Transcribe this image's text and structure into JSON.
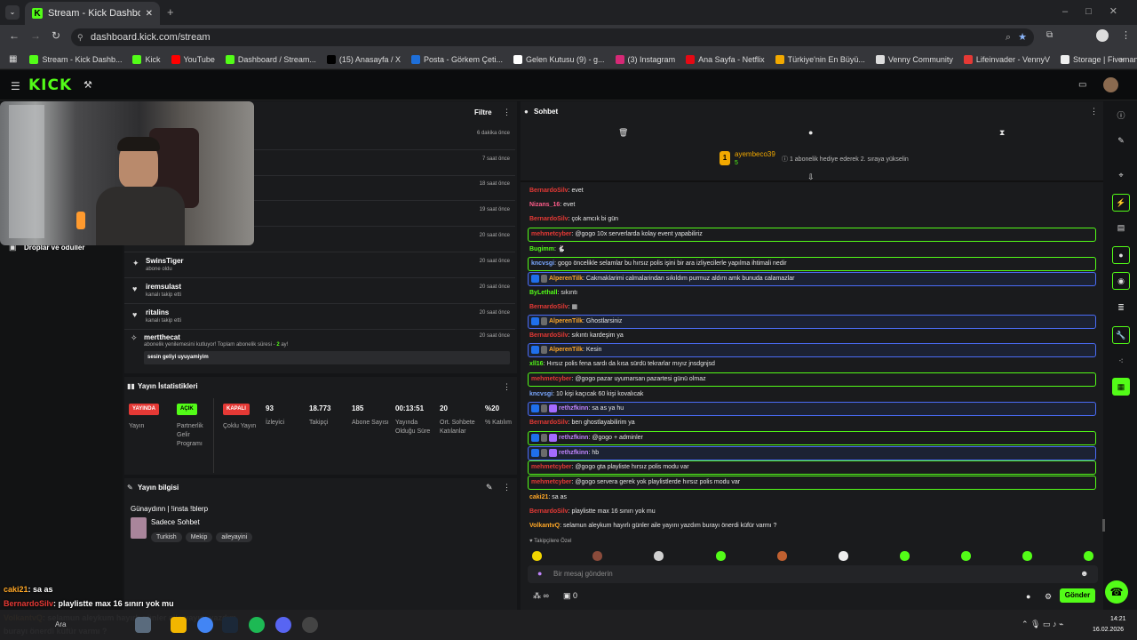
{
  "browser": {
    "tab_title": "Stream - Kick Dashboard",
    "url": "dashboard.kick.com/stream",
    "bookmarks": [
      {
        "label": "Stream - Kick Dashb...",
        "color": "#53fc18"
      },
      {
        "label": "Kick",
        "color": "#53fc18"
      },
      {
        "label": "YouTube",
        "color": "#ff0000"
      },
      {
        "label": "Dashboard / Stream...",
        "color": "#53fc18"
      },
      {
        "label": "(15) Anasayfa / X",
        "color": "#000000"
      },
      {
        "label": "Posta - Görkem Çeti...",
        "color": "#1e6fd9"
      },
      {
        "label": "Gelen Kutusu (9) - g...",
        "color": "#ffffff"
      },
      {
        "label": "(3) Instagram",
        "color": "#d62976"
      },
      {
        "label": "Ana Sayfa - Netflix",
        "color": "#e50914"
      },
      {
        "label": "Türkiye'nin En Büyü...",
        "color": "#f2a900"
      },
      {
        "label": "Venny Community",
        "color": "#dddddd"
      },
      {
        "label": "Lifeinvader - VennyV",
        "color": "#e53935"
      },
      {
        "label": "Storage | Fivemanage",
        "color": "#eeeeee"
      }
    ]
  },
  "kick": {
    "logo": "KICK"
  },
  "activity": {
    "filter_label": "Filtre",
    "items": [
      {
        "name": "",
        "sub": "",
        "time": "6 dakika önce",
        "icon": "none"
      },
      {
        "name": "",
        "sub": "",
        "time": "7 saat önce",
        "icon": "none"
      },
      {
        "name": "",
        "sub": "",
        "time": "18 saat önce",
        "icon": "none"
      },
      {
        "name": "",
        "sub": "",
        "time": "19 saat önce",
        "icon": "none"
      },
      {
        "name": "",
        "sub": "abone oldu",
        "time": "20 saat önce",
        "icon": "none"
      },
      {
        "name": "SwinsTiger",
        "sub": "abone oldu",
        "time": "20 saat önce",
        "icon": "✦"
      },
      {
        "name": "iremsulast",
        "sub": "kanalı takip etti",
        "time": "20 saat önce",
        "icon": "♥"
      },
      {
        "name": "ritalins",
        "sub": "kanalı takip etti",
        "time": "20 saat önce",
        "icon": "♥"
      }
    ],
    "resub": {
      "name": "mertthecat",
      "sub_prefix": "abonelik yenilemesini kutluyor! Toplam abonelik süresi -",
      "months": "2",
      "sub_suffix": "ay!",
      "message": "sesin geliyi uyuyamiyim",
      "time": "20 saat önce"
    }
  },
  "sidebar": {
    "drops_label": "Droplar ve ödüller"
  },
  "stats": {
    "title": "Yayın İstatistikleri",
    "badges": [
      {
        "tag": "YAYINDA",
        "label": "Yayın",
        "color": "#e53935",
        "text": "#ffffff"
      },
      {
        "tag": "AÇIK",
        "label": "Partnerlik Gelir Programı",
        "color": "#53fc18",
        "text": "#000000"
      },
      {
        "tag": "KAPALI",
        "label": "Çoklu Yayın",
        "color": "#e53935",
        "text": "#ffffff"
      }
    ],
    "values": [
      {
        "value": "93",
        "label": "İzleyici"
      },
      {
        "value": "18.773",
        "label": "Takipçi"
      },
      {
        "value": "185",
        "label": "Abone Sayısı"
      },
      {
        "value": "00:13:51",
        "label": "Yayında Olduğu Süre"
      },
      {
        "value": "20",
        "label": "Ort. Sohbete Katılanlar"
      },
      {
        "value": "%20",
        "label": "% Katılım"
      }
    ]
  },
  "stream_info": {
    "title_label": "Yayın bilgisi",
    "stream_title": "Günaydınn | !insta !blerp",
    "category": "Sadece Sohbet",
    "tags": [
      "Turkish",
      "Mekip",
      "aileyayini"
    ]
  },
  "chat": {
    "title": "Sohbet",
    "gifter_name": "ayembeco39",
    "gifter_count": "5",
    "gifter_rank": "1",
    "gifter_note": "1 abonelik hediye ederek 2. sıraya yükselin",
    "messages": [
      {
        "user": "BernardoSilv",
        "text": ": evet",
        "color": "red",
        "style": ""
      },
      {
        "user": "Nizans_16",
        "text": ": evet",
        "color": "pnk",
        "style": ""
      },
      {
        "user": "BernardoSilv",
        "text": ": çok amcık bi gün",
        "color": "red",
        "style": ""
      },
      {
        "user": "mehmetcyber",
        "text": ": @gogo 10x serverlarda kolay event yapabiliriz",
        "color": "red",
        "style": "hl"
      },
      {
        "user": "Bugimm",
        "text": ": 🐇",
        "color": "grn",
        "style": ""
      },
      {
        "user": "kncvsgi",
        "text": ": gogo öncelikle selamlar bu hırsız polis işini bir ara izliyecilerle yapılma ihtimali nedir",
        "color": "blu",
        "style": "hl"
      },
      {
        "user": "AlperenTilk",
        "text": ": Cakmaklarimi calmalarindan sıkıldım purmuz aldım amk bunuda calamazlar",
        "color": "org",
        "style": "hlb"
      },
      {
        "user": "ByLethall",
        "text": ": sıkıntı",
        "color": "grn",
        "style": ""
      },
      {
        "user": "BernardoSilv",
        "text": ": ▦",
        "color": "red",
        "style": ""
      },
      {
        "user": "AlperenTilk",
        "text": ": Ghostlarsiniz",
        "color": "org",
        "style": "hlb"
      },
      {
        "user": "BernardoSilv",
        "text": ": sıkıntı kardeşim ya",
        "color": "red",
        "style": ""
      },
      {
        "user": "AlperenTilk",
        "text": ": Kesin",
        "color": "org",
        "style": "hlb"
      },
      {
        "user": "xll16",
        "text": ": Hırsız polis fena sardı da kısa sürdü tekrarlar mıyız jnsdgnjsd",
        "color": "grn",
        "style": ""
      },
      {
        "user": "mehmetcyber",
        "text": ": @gogo pazar uyumarsan pazartesi günü olmaz",
        "color": "red",
        "style": "hl"
      },
      {
        "user": "kncvsgi",
        "text": ": 10 kişi kaçıcak 60 kişi kovalıcak",
        "color": "blu",
        "style": ""
      },
      {
        "user": "rethzfkinn",
        "text": ": sa as ya hu",
        "color": "pur",
        "style": "hlb"
      },
      {
        "user": "BernardoSilv",
        "text": ": ben ghostlayabilirim ya",
        "color": "red",
        "style": ""
      },
      {
        "user": "rethzfkinn",
        "text": ": @gogo + adminler",
        "color": "pur",
        "style": "hl"
      },
      {
        "user": "rethzfkinn",
        "text": ": hb",
        "color": "pur",
        "style": "hlb"
      },
      {
        "user": "mehmetcyber",
        "text": ": @gogo gta playliste hırsız polis modu var",
        "color": "red",
        "style": "hl"
      },
      {
        "user": "mehmetcyber",
        "text": ": @gogo servera gerek yok playlistlerde hırsız polis modu var",
        "color": "red",
        "style": "hl"
      },
      {
        "user": "caki21",
        "text": ": sa as",
        "color": "org",
        "style": ""
      },
      {
        "user": "BernardoSilv",
        "text": ": playlistte max 16 sınırı yok mu",
        "color": "red",
        "style": ""
      },
      {
        "user": "VolkantvQ",
        "text": ": selamun aleykum hayırlı günler aile yayını yazdım burayı önerdi küfür varmı ?",
        "color": "org",
        "style": ""
      }
    ],
    "followers_only": "Takipçilere Özel",
    "input_placeholder": "Bir mesaj gönderin",
    "points": "∞",
    "count": "0",
    "send_label": "Gönder"
  },
  "overlay": {
    "lines": [
      {
        "user": "caki21",
        "text": ": sa as"
      },
      {
        "user": "BernardoSilv",
        "text": ": playlistte max 16 sınırı yok mu"
      },
      {
        "user": "VolkantvQ",
        "text": ": selamun aleykum hayırlı günler aile yayını yazdım"
      },
      {
        "user": "",
        "text": "burayı önerdi küfür varmı ?"
      }
    ]
  },
  "taskbar": {
    "search": "Ara",
    "time": "14:21",
    "date": "16.02.2026"
  }
}
